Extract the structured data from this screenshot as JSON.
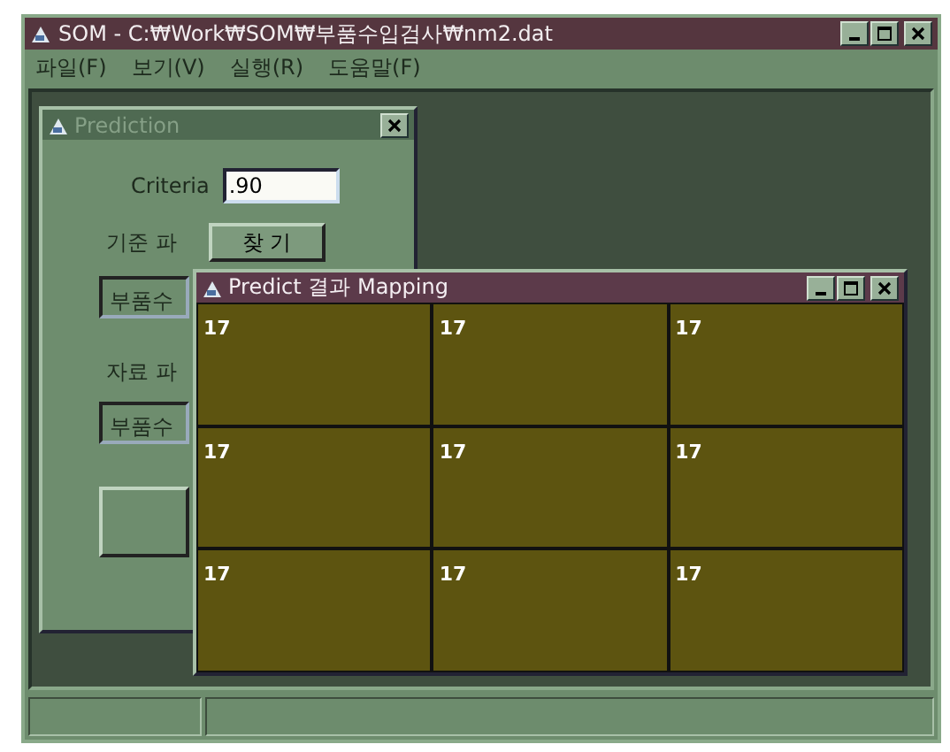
{
  "window": {
    "title": "SOM - C:₩Work₩SOM₩부품수입검사₩nm2.dat"
  },
  "menu": [
    {
      "label": "파일(F)"
    },
    {
      "label": "보기(V)"
    },
    {
      "label": "실행(R)"
    },
    {
      "label": "도움말(F)"
    }
  ],
  "prediction_window": {
    "title": "Prediction",
    "active": false,
    "criteria_label": "Criteria",
    "criteria_value": ".90",
    "base_file_label": "기준 파",
    "find_button": "찾 기",
    "base_file_value": "부품수",
    "data_file_label": "자료 파",
    "data_file_value": "부품수"
  },
  "mapping_window": {
    "title": "Predict 결과 Mapping",
    "active": true,
    "cells": [
      {
        "label": "17"
      },
      {
        "label": "17"
      },
      {
        "label": "17"
      },
      {
        "label": "17"
      },
      {
        "label": "17"
      },
      {
        "label": "17"
      },
      {
        "label": "17"
      },
      {
        "label": "17"
      },
      {
        "label": "17"
      }
    ]
  }
}
